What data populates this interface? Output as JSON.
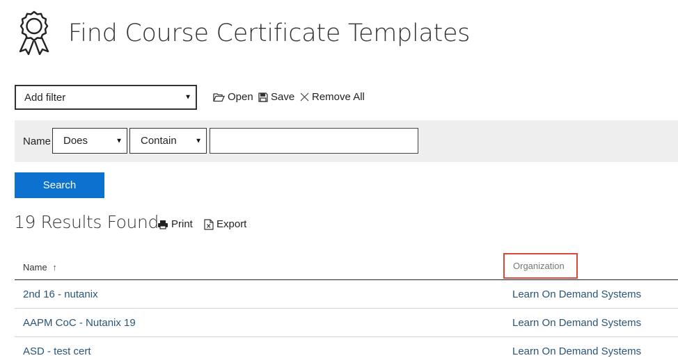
{
  "header": {
    "title": "Find Course Certificate Templates",
    "icon": "award-ribbon-icon"
  },
  "filter_bar": {
    "add_filter": {
      "value": "Add filter"
    },
    "actions": {
      "open_label": "Open",
      "save_label": "Save",
      "remove_all_label": "Remove All"
    }
  },
  "filter": {
    "field_label": "Name",
    "operator_1": "Does",
    "operator_2": "Contain",
    "value": ""
  },
  "search": {
    "label": "Search"
  },
  "results": {
    "count_text": "19 Results Found",
    "print_label": "Print",
    "export_label": "Export"
  },
  "table": {
    "columns": [
      {
        "label": "Name",
        "sort": "ascending",
        "sort_glyph": "↑"
      },
      {
        "label": "Organization"
      }
    ],
    "rows": [
      {
        "name": "2nd 16 - nutanix",
        "organization": "Learn On Demand Systems"
      },
      {
        "name": "AAPM CoC - Nutanix 19",
        "organization": "Learn On Demand Systems"
      },
      {
        "name": "ASD - test cert",
        "organization": "Learn On Demand Systems"
      }
    ]
  },
  "colors": {
    "accent": "#0d72cf",
    "link": "#2a5478",
    "highlight_box": "#d9463a",
    "panel_bg": "#eeeeee"
  }
}
